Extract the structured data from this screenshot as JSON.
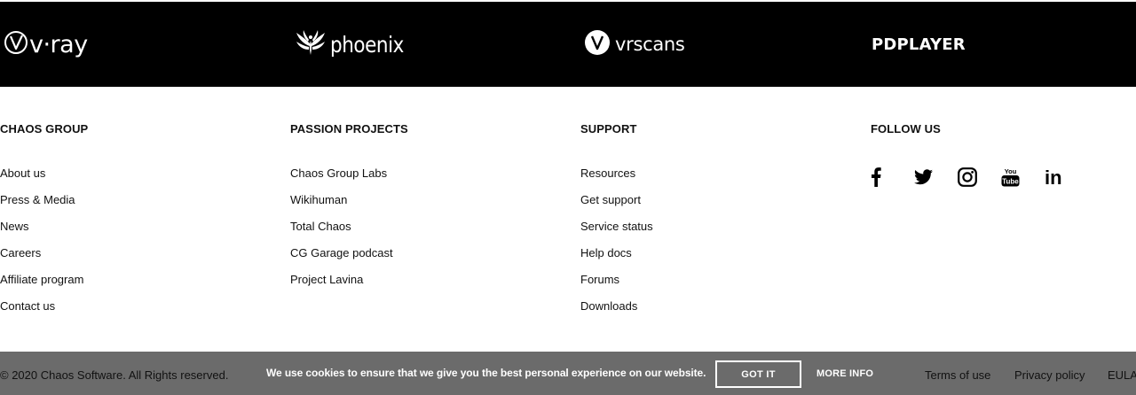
{
  "brands": [
    {
      "word": "v·ray",
      "icon": "vray-v-icon"
    },
    {
      "word": "phoenix",
      "icon": "phoenix-bird-icon"
    },
    {
      "word": "vrscans",
      "icon": "vrscans-v-icon"
    },
    {
      "word": "PDPLAYER",
      "icon": "pdplayer-logo"
    }
  ],
  "columns": {
    "chaos_group": {
      "heading": "CHAOS GROUP",
      "links": [
        "About us",
        "Press & Media",
        "News",
        "Careers",
        "Affiliate program",
        "Contact us"
      ]
    },
    "passion_projects": {
      "heading": "PASSION PROJECTS",
      "links": [
        "Chaos Group Labs",
        "Wikihuman",
        "Total Chaos",
        "CG Garage podcast",
        "Project Lavina"
      ]
    },
    "support": {
      "heading": "SUPPORT",
      "links": [
        "Resources",
        "Get support",
        "Service status",
        "Help docs",
        "Forums",
        "Downloads"
      ]
    },
    "follow_us": {
      "heading": "FOLLOW US",
      "icons": [
        "facebook-icon",
        "twitter-icon",
        "instagram-icon",
        "youtube-icon",
        "linkedin-icon"
      ],
      "youtube_text": [
        "You",
        "Tube"
      ],
      "linkedin_text": "in"
    }
  },
  "bottom_bar": {
    "copyright": "© 2020 Chaos Software. All Rights reserved.",
    "cookie_message": "We use cookies to ensure that we give you the best personal experience on our website.",
    "got_it": "GOT IT",
    "more_info": "MORE INFO",
    "terms": "Terms of use",
    "privacy": "Privacy policy",
    "eula": "EULA"
  },
  "colors": {
    "brand_bar": "#000000",
    "bottom_bar": "#6b6b6b",
    "text": "#111111",
    "cookie_text": "#ffffff"
  }
}
